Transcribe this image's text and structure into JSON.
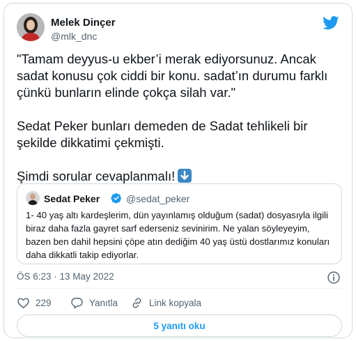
{
  "author": {
    "name": "Melek Dinçer",
    "handle": "@mlk_dnc"
  },
  "tweet": {
    "paragraphs": [
      "\"Tamam deyyus-u ekber’i merak ediyorsunuz. Ancak sadat konusu çok ciddi bir konu. sadat’ın durumu farklı çünkü bunların elinde çokça silah var.\"",
      "Sedat Peker bunları demeden de Sadat tehlikeli bir şekilde dikkatimi çekmişti.",
      "Şimdi sorular cevaplanmalı!"
    ],
    "emoji": "down-arrow-emoji"
  },
  "quoted_tweet": {
    "name": "Sedat Peker",
    "handle": "@sedat_peker",
    "verified": true,
    "text": "1- 40 yaş altı kardeşlerim, dün yayınlamış olduğum (sadat) dosyasıyla ilgili biraz daha fazla gayret sarf ederseniz sevinirim. Ne yalan söyleyeyim, bazen ben dahil hepsini çöpe atın dediğim 40 yaş üstü dostlarımız konuları daha dikkatli takip ediyorlar."
  },
  "timestamp": "ÖS 6:23 · 13 May 2022",
  "actions": {
    "like_count": "229",
    "reply_label": "Yanıtla",
    "copy_link_label": "Link kopyala"
  },
  "replies_button_label": "5 yanıtı oku",
  "colors": {
    "accent": "#1d9bf0",
    "like": "#f91880",
    "border": "#cfd9de",
    "secondary_text": "#536471"
  },
  "icons": [
    "twitter-bird-icon",
    "verified-badge-icon",
    "info-icon",
    "heart-icon",
    "reply-icon",
    "link-icon"
  ]
}
